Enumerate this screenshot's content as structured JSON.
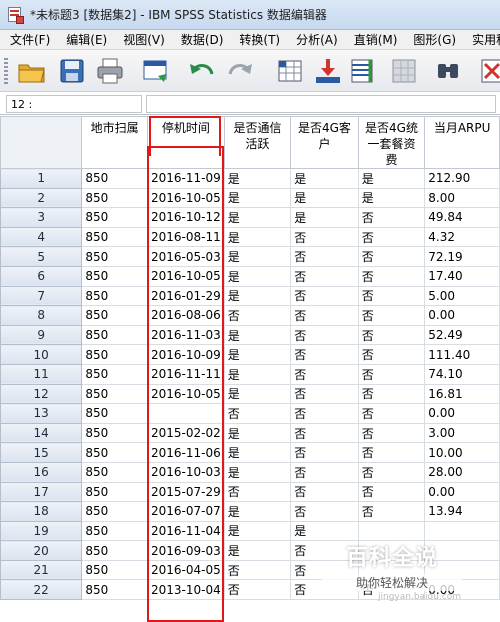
{
  "window": {
    "title": "*未标题3 [数据集2] - IBM SPSS Statistics 数据编辑器"
  },
  "menu": [
    "文件(F)",
    "编辑(E)",
    "视图(V)",
    "数据(D)",
    "转换(T)",
    "分析(A)",
    "直销(M)",
    "图形(G)",
    "实用程"
  ],
  "toolbar": {
    "icons": [
      "open-folder-icon",
      "save-icon",
      "print-icon",
      "dialog-recall-icon",
      "undo-icon",
      "redo-icon",
      "goto-case-icon",
      "goto-variable-icon",
      "variables-icon",
      "split-file-icon",
      "find-icon",
      "insert-cases-icon"
    ]
  },
  "cellbar": {
    "reference": "12 :",
    "value": ""
  },
  "grid": {
    "columns": [
      "地市扫属",
      "停机时间",
      "是否通信活跃",
      "是否4G客户",
      "是否4G统一套餐资费",
      "当月ARPU"
    ],
    "rows": [
      [
        "1",
        "850",
        "2016-11-09",
        "是",
        "是",
        "是",
        "212.90"
      ],
      [
        "2",
        "850",
        "2016-10-05",
        "是",
        "是",
        "是",
        "8.00"
      ],
      [
        "3",
        "850",
        "2016-10-12",
        "是",
        "是",
        "否",
        "49.84"
      ],
      [
        "4",
        "850",
        "2016-08-11",
        "是",
        "否",
        "否",
        "4.32"
      ],
      [
        "5",
        "850",
        "2016-05-03",
        "是",
        "否",
        "否",
        "72.19"
      ],
      [
        "6",
        "850",
        "2016-10-05",
        "是",
        "否",
        "否",
        "17.40"
      ],
      [
        "7",
        "850",
        "2016-01-29",
        "是",
        "否",
        "否",
        "5.00"
      ],
      [
        "8",
        "850",
        "2016-08-06",
        "否",
        "否",
        "否",
        "0.00"
      ],
      [
        "9",
        "850",
        "2016-11-03",
        "是",
        "否",
        "否",
        "52.49"
      ],
      [
        "10",
        "850",
        "2016-10-09",
        "是",
        "否",
        "否",
        "111.40"
      ],
      [
        "11",
        "850",
        "2016-11-11",
        "是",
        "否",
        "否",
        "74.10"
      ],
      [
        "12",
        "850",
        "2016-10-05",
        "是",
        "否",
        "否",
        "16.81"
      ],
      [
        "13",
        "850",
        "",
        "否",
        "否",
        "否",
        "0.00"
      ],
      [
        "14",
        "850",
        "2015-02-02",
        "是",
        "否",
        "否",
        "3.00"
      ],
      [
        "15",
        "850",
        "2016-11-06",
        "是",
        "否",
        "否",
        "10.00"
      ],
      [
        "16",
        "850",
        "2016-10-03",
        "是",
        "否",
        "否",
        "28.00"
      ],
      [
        "17",
        "850",
        "2015-07-29",
        "否",
        "否",
        "否",
        "0.00"
      ],
      [
        "18",
        "850",
        "2016-07-07",
        "是",
        "否",
        "否",
        "13.94"
      ],
      [
        "19",
        "850",
        "2016-11-04",
        "是",
        "是",
        "",
        ""
      ],
      [
        "20",
        "850",
        "2016-09-03",
        "是",
        "否",
        "",
        ""
      ],
      [
        "21",
        "850",
        "2016-04-05",
        "否",
        "否",
        "",
        ""
      ],
      [
        "22",
        "850",
        "2013-10-04",
        "否",
        "否",
        "否",
        "0.00"
      ]
    ]
  },
  "watermark": {
    "title": "百科全说",
    "subtitle": "助你轻松解决",
    "url": "jingyan.baidu.com"
  }
}
